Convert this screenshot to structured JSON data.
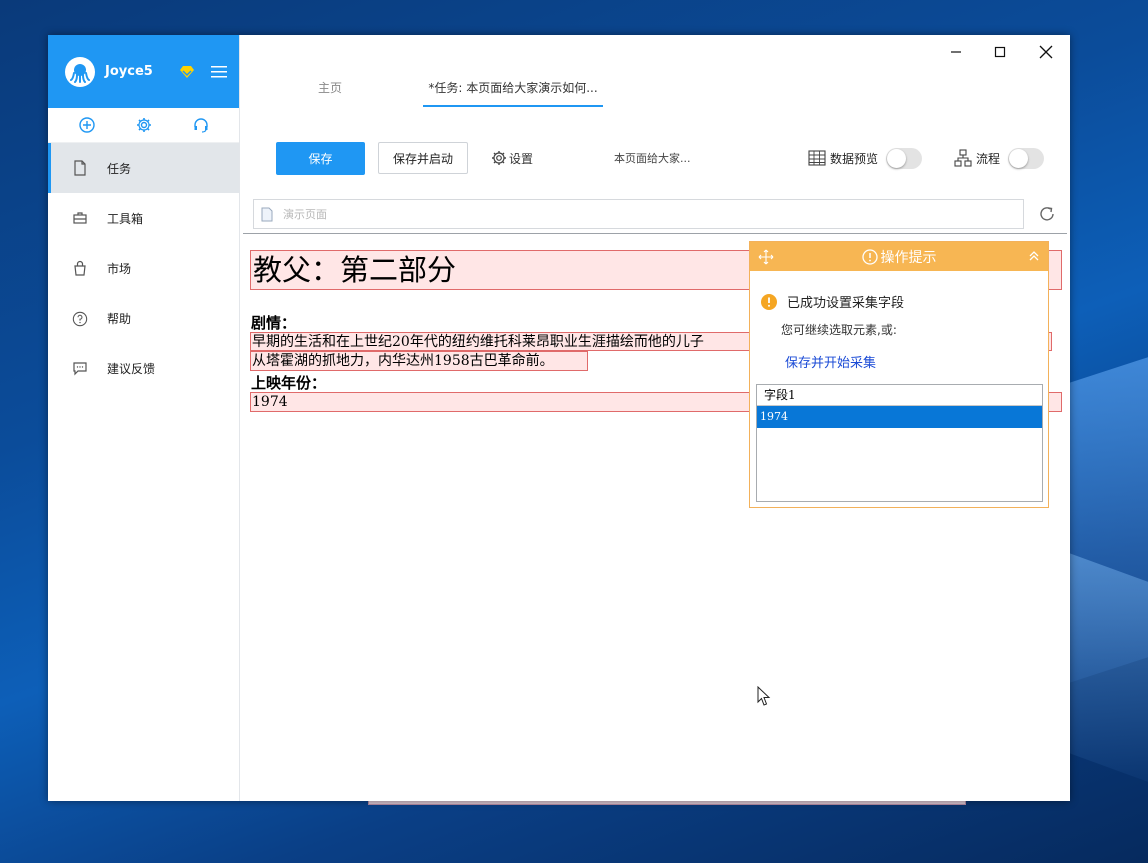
{
  "user": {
    "name": "Joyce5"
  },
  "sidebar": {
    "items": [
      {
        "label": "任务",
        "icon": "file-icon"
      },
      {
        "label": "工具箱",
        "icon": "toolbox-icon"
      },
      {
        "label": "市场",
        "icon": "bag-icon"
      },
      {
        "label": "帮助",
        "icon": "help-icon"
      },
      {
        "label": "建议反馈",
        "icon": "feedback-icon"
      }
    ]
  },
  "tabs": [
    {
      "label": "主页"
    },
    {
      "label": "*任务: 本页面给大家演示如何..."
    }
  ],
  "toolbar": {
    "save": "保存",
    "save_start": "保存并启动",
    "settings": "设置",
    "task_name": "本页面给大家...",
    "data_preview": "数据预览",
    "flow": "流程"
  },
  "url": {
    "value": "演示页面"
  },
  "web": {
    "title": "教父：第二部分",
    "plot_label": "剧情：",
    "plot_line1": "早期的生活和在上世纪20年代的纽约维托科莱昂职业生涯描绘而他的儿子",
    "plot_line2": "从塔霍湖的抓地力，内华达州1958古巴革命前。",
    "year_label": "上映年份：",
    "year_value": "1974"
  },
  "popup": {
    "title": "操作提示",
    "status": "已成功设置采集字段",
    "subtext": "您可继续选取元素,或:",
    "link": "保存并开始采集",
    "field_header": "字段1",
    "field_value": "1974"
  },
  "colors": {
    "accent": "#1f97f3",
    "popup": "#f7b653",
    "highlight_border": "#e06a6a",
    "selected_row": "#0877d7"
  }
}
